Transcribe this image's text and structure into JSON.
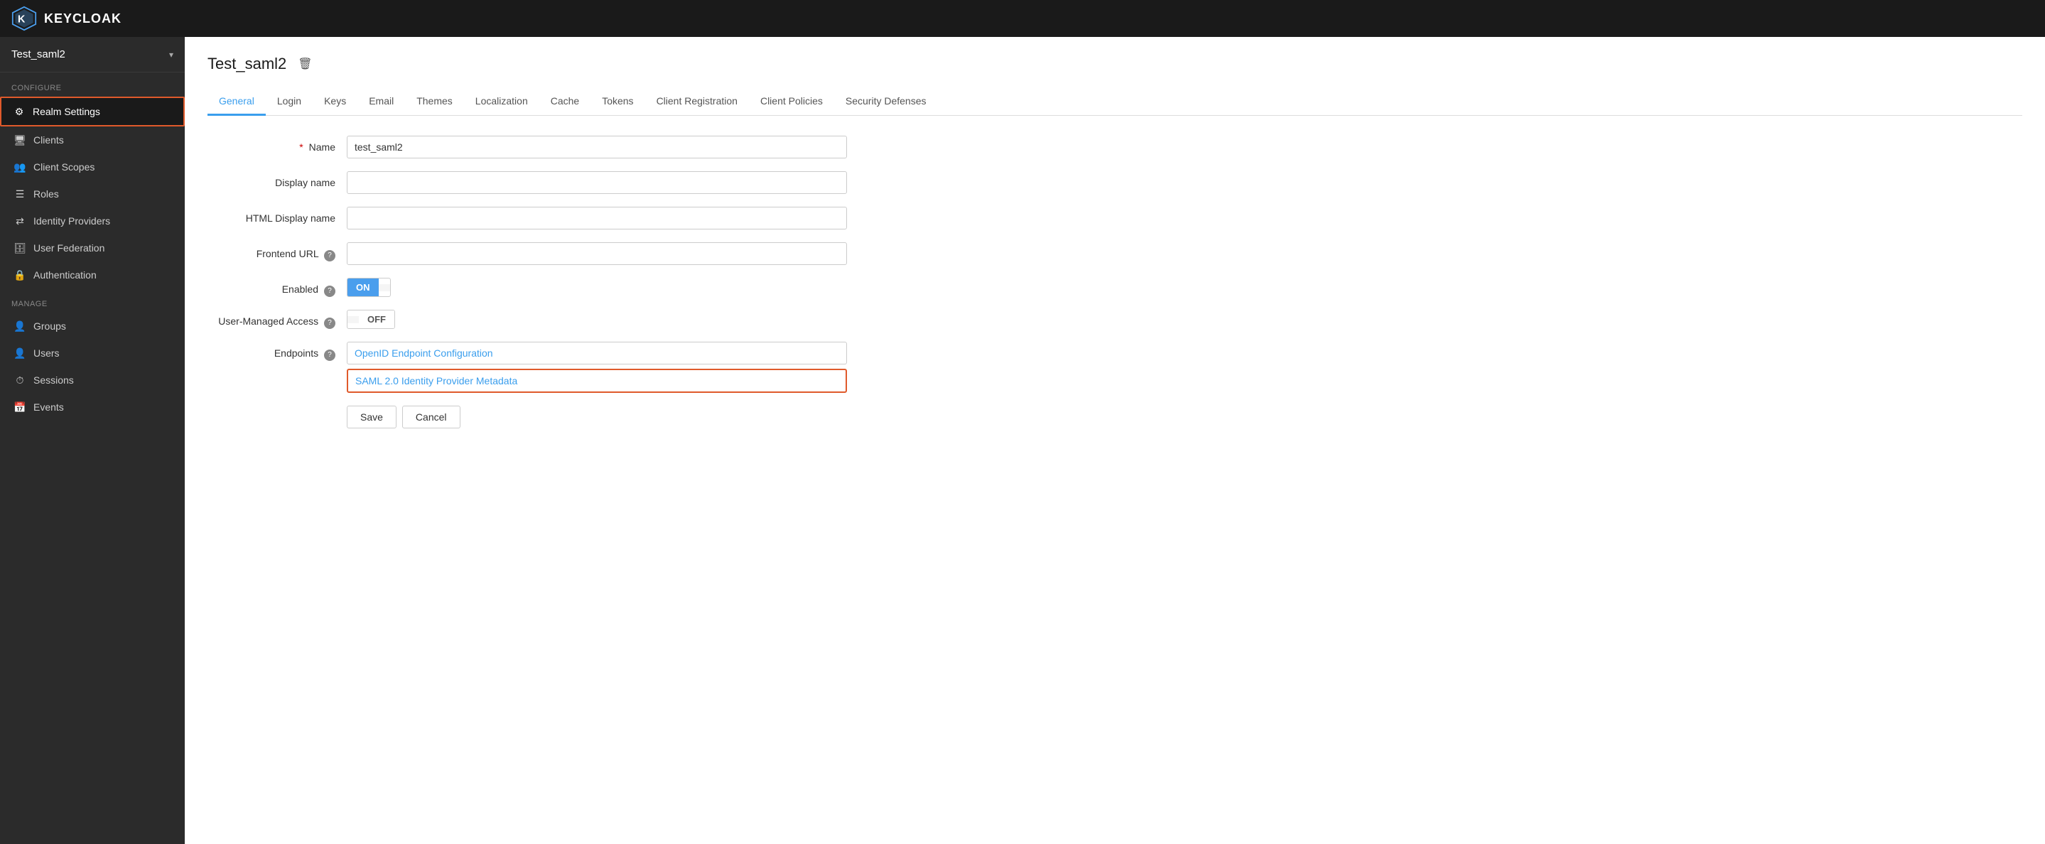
{
  "header": {
    "logo_text": "KEYCLOAK"
  },
  "sidebar": {
    "realm_name": "Test_saml2",
    "configure_label": "Configure",
    "manage_label": "Manage",
    "items_configure": [
      {
        "id": "realm-settings",
        "label": "Realm Settings",
        "icon": "⚙",
        "active": true
      },
      {
        "id": "clients",
        "label": "Clients",
        "icon": "🖥"
      },
      {
        "id": "client-scopes",
        "label": "Client Scopes",
        "icon": "👥"
      },
      {
        "id": "roles",
        "label": "Roles",
        "icon": "☰"
      },
      {
        "id": "identity-providers",
        "label": "Identity Providers",
        "icon": "🔗"
      },
      {
        "id": "user-federation",
        "label": "User Federation",
        "icon": "🗄"
      },
      {
        "id": "authentication",
        "label": "Authentication",
        "icon": "🔒"
      }
    ],
    "items_manage": [
      {
        "id": "groups",
        "label": "Groups",
        "icon": "👤"
      },
      {
        "id": "users",
        "label": "Users",
        "icon": "👤"
      },
      {
        "id": "sessions",
        "label": "Sessions",
        "icon": "⏱"
      },
      {
        "id": "events",
        "label": "Events",
        "icon": "📅"
      }
    ]
  },
  "page": {
    "title": "Test_saml2",
    "tabs": [
      {
        "id": "general",
        "label": "General",
        "active": true
      },
      {
        "id": "login",
        "label": "Login"
      },
      {
        "id": "keys",
        "label": "Keys"
      },
      {
        "id": "email",
        "label": "Email"
      },
      {
        "id": "themes",
        "label": "Themes"
      },
      {
        "id": "localization",
        "label": "Localization"
      },
      {
        "id": "cache",
        "label": "Cache"
      },
      {
        "id": "tokens",
        "label": "Tokens"
      },
      {
        "id": "client-registration",
        "label": "Client Registration"
      },
      {
        "id": "client-policies",
        "label": "Client Policies"
      },
      {
        "id": "security-defenses",
        "label": "Security Defenses"
      }
    ],
    "form": {
      "name_label": "Name",
      "name_value": "test_saml2",
      "display_name_label": "Display name",
      "html_display_name_label": "HTML Display name",
      "frontend_url_label": "Frontend URL",
      "enabled_label": "Enabled",
      "toggle_on": "ON",
      "user_managed_access_label": "User-Managed Access",
      "toggle_off": "OFF",
      "endpoints_label": "Endpoints",
      "endpoint1": "OpenID Endpoint Configuration",
      "endpoint2": "SAML 2.0 Identity Provider Metadata",
      "save_label": "Save",
      "cancel_label": "Cancel"
    }
  }
}
